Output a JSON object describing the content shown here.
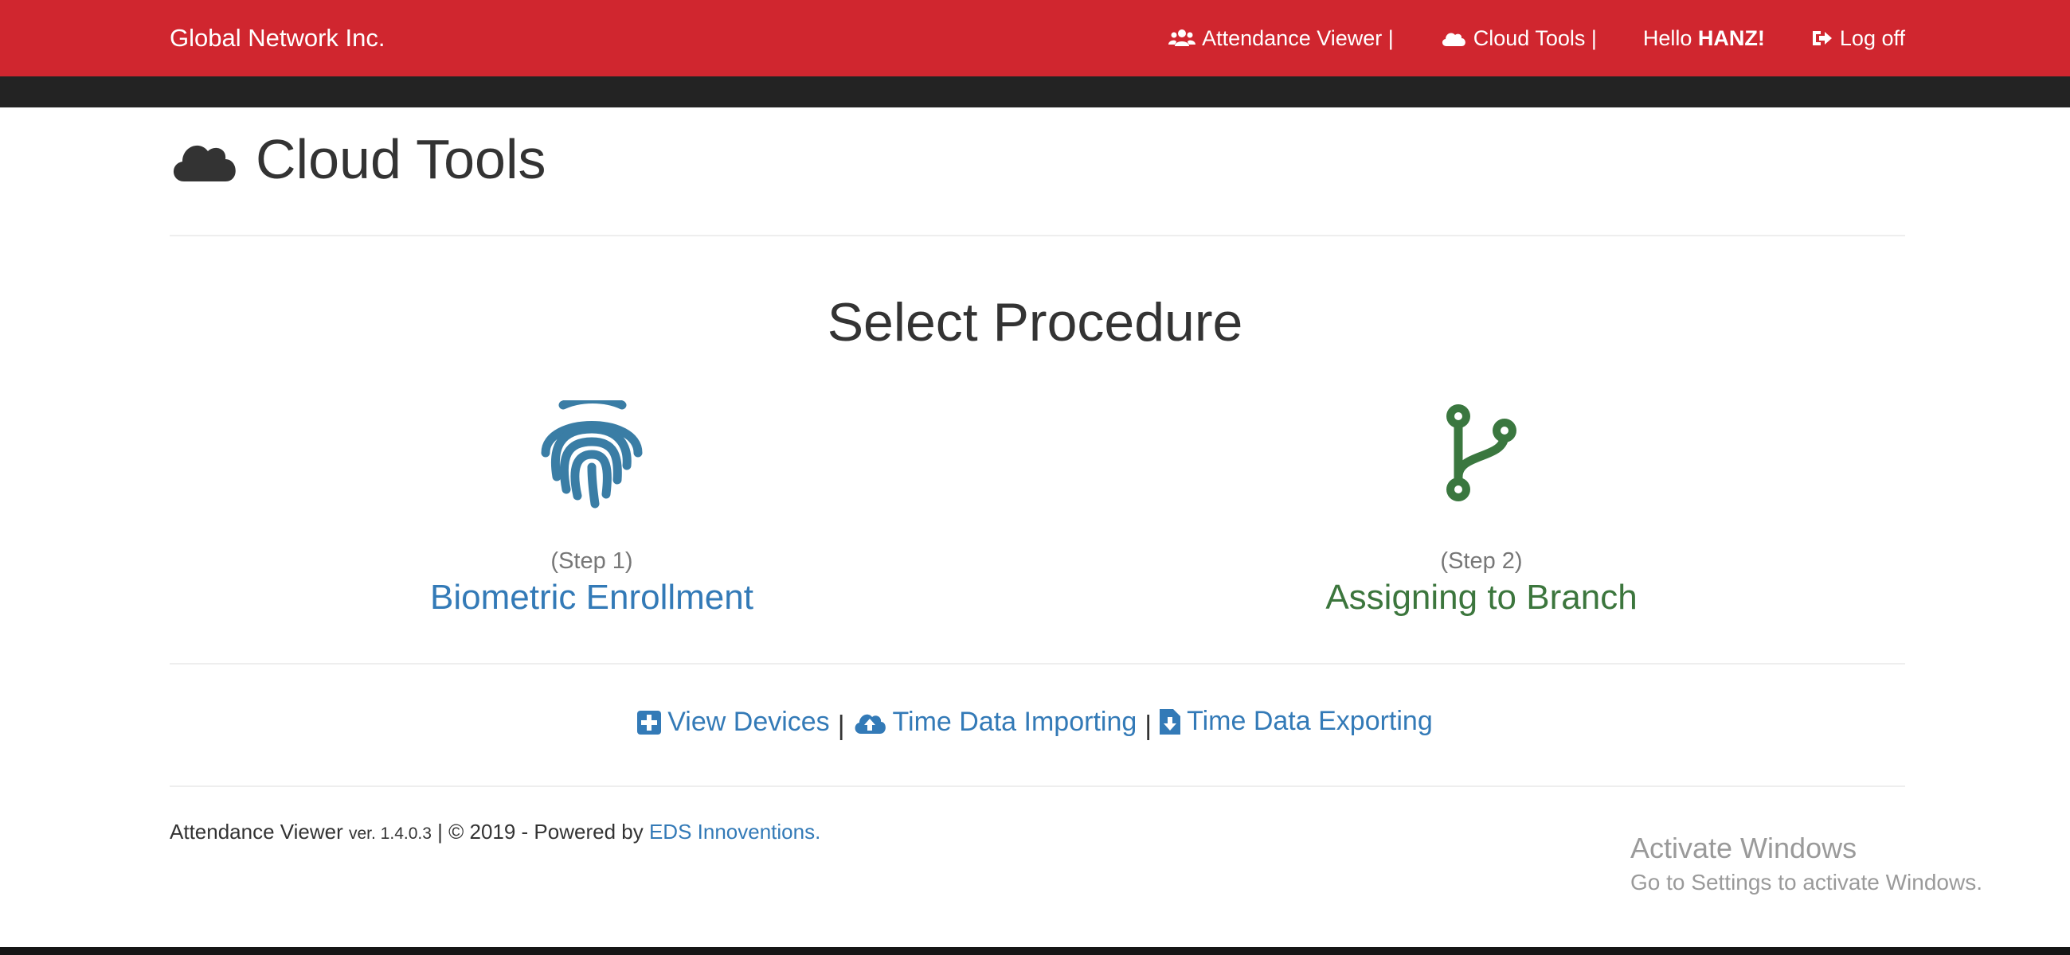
{
  "navbar": {
    "brand": "Global Network Inc.",
    "attendance_viewer": "Attendance Viewer |",
    "cloud_tools": "Cloud Tools |",
    "greeting_prefix": "Hello ",
    "username": "HANZ!",
    "logoff": "Log off"
  },
  "page": {
    "title": "Cloud Tools"
  },
  "procedure": {
    "heading": "Select Procedure",
    "step1": {
      "step": "(Step 1)",
      "label": "Biometric Enrollment",
      "icon": "fingerprint-icon"
    },
    "step2": {
      "step": "(Step 2)",
      "label": "Assigning to Branch",
      "icon": "branch-icon"
    }
  },
  "links": {
    "view_devices": "View Devices",
    "separator": "|",
    "import": "Time Data Importing",
    "export": "Time Data Exporting"
  },
  "footer": {
    "app": "Attendance Viewer ",
    "version": "ver. 1.4.0.3",
    "copyright": " | © 2019 - Powered by ",
    "company": "EDS Innoventions."
  },
  "watermark": {
    "line1": "Activate Windows",
    "line2": "Go to Settings to activate Windows."
  },
  "colors": {
    "navbar": "#d0262f",
    "link_blue": "#337ab7",
    "success_green": "#3c763d",
    "fingerprint": "#3a7da5",
    "branch": "#3a773f"
  }
}
